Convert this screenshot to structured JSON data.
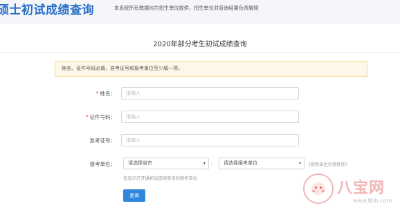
{
  "header": {
    "site_title": "硕士初试成绩查询",
    "note": "本系统所有数据均为招生单位提供，招生单位对查询结果负责解释"
  },
  "main": {
    "title": "2020年部分考生初试成绩查询",
    "notice": "姓名、证件号码必填，准考证号和报考单位至少填一项。"
  },
  "form": {
    "name_label": "姓名：",
    "id_label": "证件号码：",
    "exam_no_label": "准考证号：",
    "unit_label": "报考单位：",
    "required_mark": "*",
    "name_placeholder": "请输入",
    "id_placeholder": "请输入",
    "exam_no_placeholder": "请输入",
    "province_select": "请选择省市",
    "unit_select": "请选择报考单位",
    "dash": "-",
    "sort_hint": "(按照单位名称排序)",
    "scope_hint": "仅显示已开通初试成绩查询的报考单位",
    "query_button": "查询"
  },
  "watermark": {
    "text": "八宝网",
    "url": "www.8bb.com"
  },
  "colors": {
    "brand": "#2a6fc7",
    "button": "#2f86dd",
    "required": "#e34848",
    "notice_bg": "#fdf7e7",
    "notice_border": "#f5d98c"
  },
  "icons": {
    "select_caret": "▾"
  }
}
